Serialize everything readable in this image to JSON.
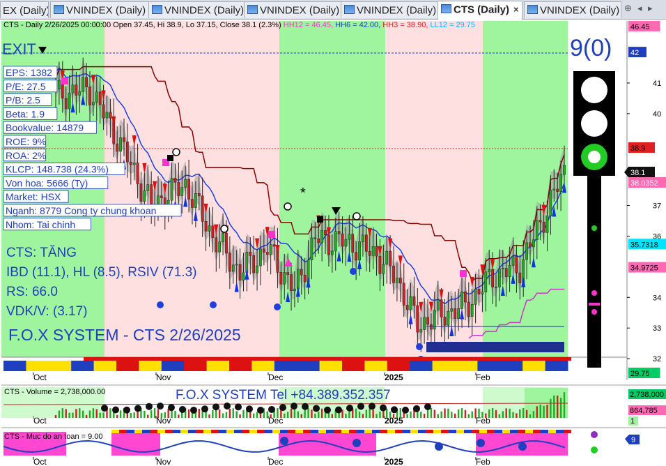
{
  "tabs": [
    {
      "label": "EX (Daily)",
      "active": false
    },
    {
      "label": "VNINDEX (Daily)",
      "active": false
    },
    {
      "label": "VNINDEX (Daily)",
      "active": false
    },
    {
      "label": "VNINDEX (Daily)",
      "active": false
    },
    {
      "label": "VNINDEX (Daily)",
      "active": false
    },
    {
      "label": "CTS (Daily)",
      "active": true
    },
    {
      "label": "VNINDEX (Daily)",
      "active": false
    }
  ],
  "tab_close": "×",
  "nav": {
    "prev": "◂",
    "next": "▸"
  },
  "header": {
    "main": "CTS - Daily 2/26/2025 00:00:00 Open 37.45, Hi 38.9, Lo 37.15, Close 38.1 (2.3%)",
    "hh12": "HH12 = 46.45,",
    "hh6": "HH6 = 42.00,",
    "hh3": "HH3 = 38.90,",
    "ll12": "LL12 = 29.75"
  },
  "exit_label": "EXIT",
  "score": "9(0)",
  "info_box": [
    "EPS: 1382",
    "P/E: 27.5",
    "P/B: 2.5",
    "Beta: 1.9",
    "Bookvalue: 14879",
    "ROE: 9%",
    "ROA: 2%",
    "KLCP: 148.738 (24.3%)",
    "Von hoa: 5666 (Ty)",
    "Market: HSX",
    "Nganh: 8779 Cong ty chung khoan",
    "Nhom: Tai chinh"
  ],
  "trend": [
    "CTS: TĂNG",
    "IBD (11.1), HL (8.5), RSIV (71.3)",
    "RS: 66.0",
    "VDK/V:  (3.17)"
  ],
  "watermark": "F.O.X SYSTEM - CTS 2/26/2025",
  "price_axis": [
    {
      "label": "46.45",
      "kind": "box",
      "bg": "#ff69b4",
      "fg": "#000",
      "price": 46.45
    },
    {
      "label": "42",
      "kind": "box",
      "bg": "#1f3fbf",
      "fg": "#fff",
      "price": 42
    },
    {
      "label": "41",
      "kind": "tick",
      "price": 41
    },
    {
      "label": "40",
      "kind": "tick",
      "price": 40
    },
    {
      "label": "38.9",
      "kind": "box",
      "bg": "#e02020",
      "fg": "#000",
      "price": 38.9
    },
    {
      "label": "38.1",
      "kind": "box",
      "bg": "#111",
      "fg": "#fff",
      "price": 38.1
    },
    {
      "label": "38.0352",
      "kind": "box",
      "bg": "#ff69b4",
      "fg": "#fff",
      "price": 38.0352
    },
    {
      "label": "37",
      "kind": "tick",
      "price": 37
    },
    {
      "label": "36",
      "kind": "tick",
      "price": 36
    },
    {
      "label": "35.7318",
      "kind": "box",
      "bg": "#00e5ff",
      "fg": "#000",
      "price": 35.7318
    },
    {
      "label": "34.9725",
      "kind": "box",
      "bg": "#ff69b4",
      "fg": "#000",
      "price": 34.9725
    },
    {
      "label": "34",
      "kind": "tick",
      "price": 34
    },
    {
      "label": "33",
      "kind": "tick",
      "price": 33
    },
    {
      "label": "32",
      "kind": "tick",
      "price": 32
    },
    {
      "label": "29.75",
      "kind": "box",
      "bg": "#00cc66",
      "fg": "#000",
      "price": 29.75
    }
  ],
  "x_labels": [
    "Oct",
    "Nov",
    "Dec",
    "2025",
    "Feb"
  ],
  "volume": {
    "label": "CTS - Volume = 2,738,000.00",
    "title": "F.O.X SYSTEM Tel +84.389.352.357",
    "axis": [
      "2,738,000",
      "864,785",
      "1"
    ]
  },
  "safety": {
    "label": "CTS - Muc do an toan = 9.00",
    "axis": "9"
  },
  "colors": {
    "green_zone": "#9ef59e",
    "pink_zone": "#ffe0e0",
    "accent_blue": "#1f3fbf",
    "text_blue": "#1f3fbf"
  }
}
